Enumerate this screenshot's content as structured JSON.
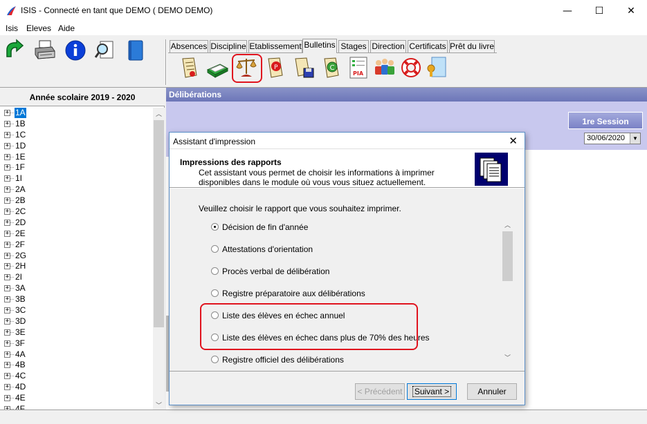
{
  "window": {
    "title": "ISIS - Connecté en tant que DEMO ( DEMO DEMO)",
    "minimize": "—",
    "maximize": "☐",
    "close": "✕"
  },
  "menu": {
    "items": [
      {
        "label": "Isis"
      },
      {
        "label": "Eleves"
      },
      {
        "label": "Aide"
      }
    ]
  },
  "toolbar": {
    "icons": [
      "refresh-icon",
      "printer-icon",
      "info-icon",
      "search-icon",
      "book-icon"
    ]
  },
  "tabs": [
    {
      "label": "Absences"
    },
    {
      "label": "Discipline"
    },
    {
      "label": "Etablissement"
    },
    {
      "label": "Bulletins",
      "active": true
    },
    {
      "label": "Stages"
    },
    {
      "label": "Direction"
    },
    {
      "label": "Certificats"
    },
    {
      "label": "Prêt du livre"
    }
  ],
  "module_icons": {
    "pia_label": "PIA"
  },
  "left_panel": {
    "header": "Année scolaire 2019 - 2020",
    "classes": [
      "1A",
      "1B",
      "1C",
      "1D",
      "1E",
      "1F",
      "1I",
      "2A",
      "2B",
      "2C",
      "2D",
      "2E",
      "2F",
      "2G",
      "2H",
      "2I",
      "3A",
      "3B",
      "3C",
      "3D",
      "3E",
      "3F",
      "4A",
      "4B",
      "4C",
      "4D",
      "4E",
      "4F"
    ],
    "selected": "1A"
  },
  "right_panel": {
    "header": "Délibérations",
    "session_button": "1re Session",
    "date": "30/06/2020"
  },
  "dialog": {
    "title": "Assistant d'impression",
    "close": "✕",
    "heading": "Impressions des rapports",
    "description": "Cet assistant vous permet de choisir les informations à imprimer disponibles dans le module où vous vous situez actuellement.",
    "prompt": "Veuillez choisir le rapport que vous souhaitez imprimer.",
    "options": [
      {
        "label": "Décision de fin d'année",
        "checked": true
      },
      {
        "label": "Attestations d'orientation",
        "checked": false
      },
      {
        "label": "Procès verbal de délibération",
        "checked": false
      },
      {
        "label": "Registre préparatoire aux délibérations",
        "checked": false
      },
      {
        "label": "Liste des élèves en échec annuel",
        "checked": false
      },
      {
        "label": "Liste des élèves en échec dans plus de 70% des heures",
        "checked": false
      },
      {
        "label": "Registre officiel des délibérations",
        "checked": false
      }
    ],
    "buttons": {
      "previous": "< Précédent",
      "next": "Suivant >",
      "cancel": "Annuler"
    }
  },
  "colors": {
    "highlight": "#e0131e",
    "selection": "#0078d7",
    "header_purple": "#7880be",
    "band_purple": "#c8c8ee"
  }
}
